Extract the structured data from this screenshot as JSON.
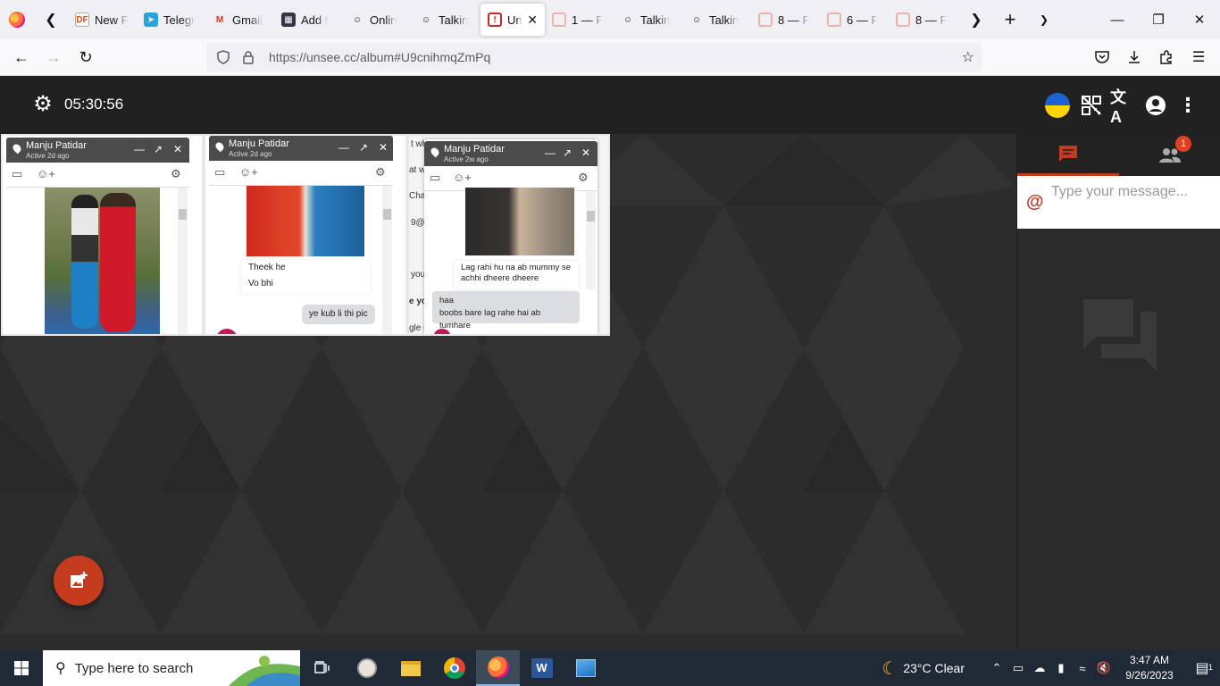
{
  "browser": {
    "tabs": [
      {
        "title": "New F",
        "favicon": "dzone-icon"
      },
      {
        "title": "Telegr",
        "favicon": "telegram-icon"
      },
      {
        "title": "Gmail",
        "favicon": "gmail-icon"
      },
      {
        "title": "Add t",
        "favicon": "extension-icon"
      },
      {
        "title": "Onlin",
        "favicon": "mask-icon"
      },
      {
        "title": "Talkin",
        "favicon": "mask-icon"
      },
      {
        "title": "Un",
        "favicon": "unsee-icon",
        "active": true
      },
      {
        "title": "1 — F",
        "favicon": "ghost-icon"
      },
      {
        "title": "Talkin",
        "favicon": "mask-icon"
      },
      {
        "title": "Talkin",
        "favicon": "mask-icon"
      },
      {
        "title": "8 — F",
        "favicon": "ghost-icon"
      },
      {
        "title": "6 — F",
        "favicon": "ghost-icon"
      },
      {
        "title": "8 — F",
        "favicon": "ghost-icon"
      }
    ],
    "url": "https://unsee.cc/album#U9cnihmqZmPq"
  },
  "page": {
    "timer": "05:30:56",
    "accent_color": "#c43b1e",
    "screenshots": [
      {
        "name": "Manju Patidar",
        "status": "Active 2d ago",
        "messages": []
      },
      {
        "name": "Manju Patidar",
        "status": "Active 2d ago",
        "messages": [
          "Theek he",
          "Vo bhi",
          "ye kub li thi pic"
        ]
      },
      {
        "name": "Manju Patidar",
        "status": "Active 2w ago",
        "messages": [
          "Lag rahi hu na ab mummy se",
          "achhi dheere dheere",
          "haa",
          "boobs bare lag rahe hai ab tumhare"
        ],
        "fragments": [
          "t wh",
          "at wi",
          "Chat",
          "9@",
          "you",
          "e you",
          "gle C"
        ]
      }
    ]
  },
  "chat_panel": {
    "users_badge": "1",
    "input_placeholder": "Type your message..."
  },
  "taskbar": {
    "search_placeholder": "Type here to search",
    "weather": "23°C  Clear",
    "time": "3:47 AM",
    "date": "9/26/2023",
    "notification_count": "1"
  }
}
